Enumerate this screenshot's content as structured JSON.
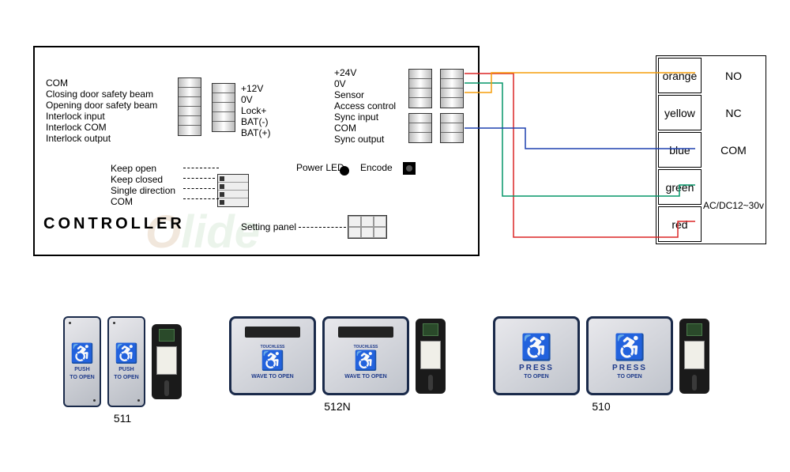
{
  "controller": {
    "title": "CONTROLLER",
    "left_labels": [
      "COM",
      "Closing door safety beam",
      "Opening door safety beam",
      "Interlock input",
      "Interlock COM",
      "Interlock output"
    ],
    "mid_labels": [
      "+12V",
      "0V",
      "Lock+",
      "BAT(-)",
      "BAT(+)"
    ],
    "right_labels": [
      "+24V",
      "0V",
      "Sensor",
      "Access control",
      "Sync input",
      "COM",
      "Sync output"
    ],
    "keep_labels": [
      "Keep open",
      "Keep closed",
      "Single direction",
      "COM"
    ],
    "power_led_label": "Power LED",
    "encode_label": "Encode",
    "setting_panel_label": "Setting panel",
    "watermark": "Olide"
  },
  "wire_terminals": {
    "rows": [
      {
        "color": "orange",
        "function": "NO"
      },
      {
        "color": "yellow",
        "function": "NC"
      },
      {
        "color": "blue",
        "function": "COM"
      },
      {
        "color": "green",
        "function": "AC/DC12~30v"
      },
      {
        "color": "red",
        "function": "AC/DC12~30v"
      }
    ]
  },
  "products": [
    {
      "model": "511",
      "buttons": [
        {
          "type": "slim",
          "icon": "wheelchair",
          "text_top": "PUSH",
          "text_bot": "TO OPEN"
        },
        {
          "type": "slim",
          "icon": "wheelchair",
          "text_top": "PUSH",
          "text_bot": "TO OPEN"
        }
      ]
    },
    {
      "model": "512N",
      "buttons": [
        {
          "type": "square",
          "touchless": true,
          "touchless_label": "TOUCHLESS",
          "icon": "wheelchair",
          "text_bot": "WAVE TO OPEN"
        },
        {
          "type": "square",
          "touchless": true,
          "touchless_label": "TOUCHLESS",
          "icon": "wheelchair",
          "text_bot": "WAVE TO OPEN"
        }
      ]
    },
    {
      "model": "510",
      "buttons": [
        {
          "type": "square",
          "icon": "wheelchair",
          "text_top": "PRESS",
          "text_bot": "TO OPEN"
        },
        {
          "type": "square",
          "icon": "wheelchair",
          "text_top": "PRESS",
          "text_bot": "TO OPEN"
        }
      ]
    }
  ],
  "wire_colors": {
    "orange": "#f59e0b",
    "yellow": "#d4b000",
    "blue": "#1e40af",
    "green": "#059669",
    "red": "#dc2626"
  }
}
